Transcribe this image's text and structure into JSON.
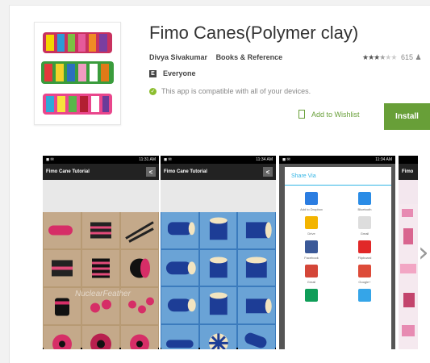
{
  "app": {
    "title": "Fimo Canes(Polymer clay)",
    "developer": "Divya Sivakumar",
    "category": "Books & Reference",
    "rating_stars": 3.5,
    "stars_on": "★★★",
    "stars_half": "★",
    "stars_off": "★★",
    "rating_count": "615",
    "content_rating": "Everyone",
    "content_rating_badge": "E",
    "compatibility": "This app is compatible with all of your devices.",
    "wishlist_label": "Add to Wishlist",
    "install_label": "Install"
  },
  "screenshots": [
    {
      "status_time": "11:31 AM",
      "status_left": "◼ ✉",
      "app_bar_title": "Fimo Cane Tutorial",
      "watermark": "NuclearFeather"
    },
    {
      "status_time": "11:34 AM",
      "status_left": "◼ ✉",
      "app_bar_title": "Fimo Cane Tutorial"
    },
    {
      "status_time": "11:34 AM",
      "status_left": "◼ ✉",
      "share_title": "Share Via",
      "share_items": [
        {
          "label": "Add to Dropbox",
          "icon": "dropbox-icon",
          "color": "#2b7de1"
        },
        {
          "label": "Bluetooth",
          "icon": "bluetooth-icon",
          "color": "#2a8ce6"
        },
        {
          "label": "Drive",
          "icon": "drive-icon",
          "color": "#f3b400"
        },
        {
          "label": "Gmail",
          "icon": "gmail-icon",
          "color": "#dddddd"
        },
        {
          "label": "Facebook",
          "icon": "facebook-icon",
          "color": "#3b5998"
        },
        {
          "label": "Flipboard",
          "icon": "flipboard-icon",
          "color": "#e12828"
        },
        {
          "label": "Gmail",
          "icon": "gmail-icon",
          "color": "#d44638"
        },
        {
          "label": "Google+",
          "icon": "googleplus-icon",
          "color": "#dd4b39"
        },
        {
          "label": "",
          "icon": "hangouts-icon",
          "color": "#0f9d58"
        },
        {
          "label": "",
          "icon": "messaging-icon",
          "color": "#35a5e8"
        }
      ]
    },
    {
      "status_time": "",
      "app_bar_title": "Fimo"
    }
  ],
  "colors": {
    "accent": "#689f38",
    "install_bg": "#689f38",
    "compat_dot": "#8cbe2f",
    "share_header": "#33b5e5"
  },
  "icons": {
    "wishlist": "bookmark-plus-icon",
    "compat": "check-circle-icon",
    "next": "chevron-right-icon",
    "rating_count_person": "person-icon"
  }
}
